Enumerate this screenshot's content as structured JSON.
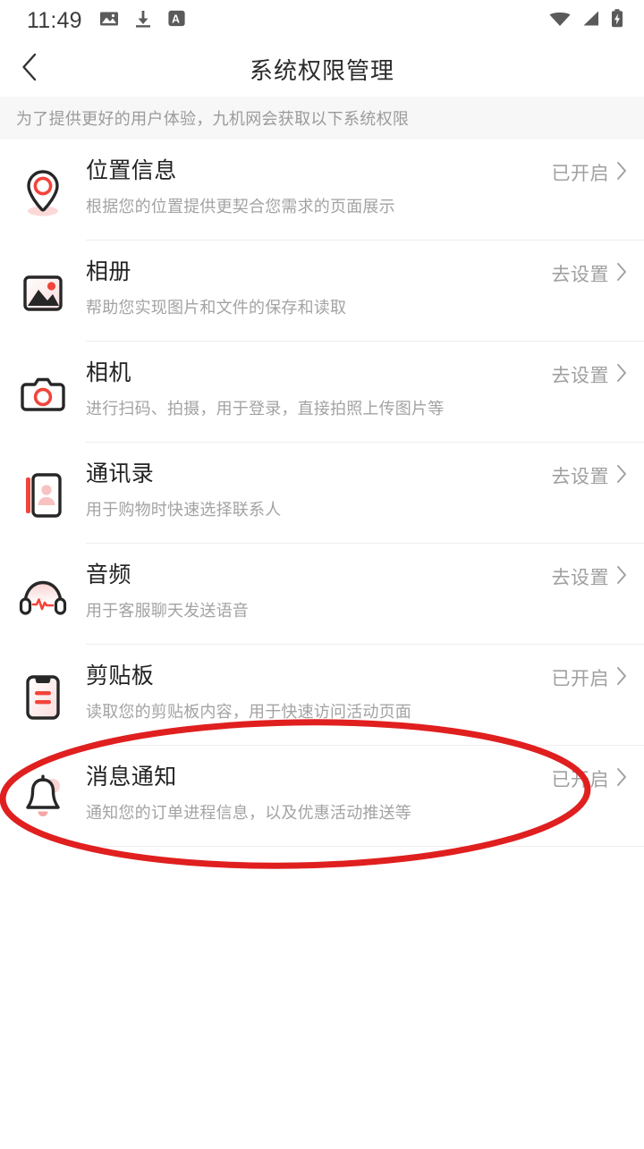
{
  "status_bar": {
    "time": "11:49",
    "left_icons": [
      "image-icon",
      "download-icon",
      "letter-a-icon"
    ],
    "right_icons": [
      "wifi-icon",
      "cellular-signal-icon",
      "battery-charging-icon"
    ]
  },
  "header": {
    "back_icon": "chevron-left-icon",
    "title": "系统权限管理"
  },
  "banner": {
    "text": "为了提供更好的用户体验，九机网会获取以下系统权限"
  },
  "permissions": [
    {
      "icon": "location-pin-icon",
      "title": "位置信息",
      "desc": "根据您的位置提供更契合您需求的页面展示",
      "status": "已开启"
    },
    {
      "icon": "photo-album-icon",
      "title": "相册",
      "desc": "帮助您实现图片和文件的保存和读取",
      "status": "去设置"
    },
    {
      "icon": "camera-icon",
      "title": "相机",
      "desc": "进行扫码、拍摄，用于登录，直接拍照上传图片等",
      "status": "去设置"
    },
    {
      "icon": "contacts-icon",
      "title": "通讯录",
      "desc": "用于购物时快速选择联系人",
      "status": "去设置"
    },
    {
      "icon": "headphones-icon",
      "title": "音频",
      "desc": "用于客服聊天发送语音",
      "status": "去设置"
    },
    {
      "icon": "clipboard-icon",
      "title": "剪贴板",
      "desc": "读取您的剪贴板内容，用于快速访问活动页面",
      "status": "已开启"
    },
    {
      "icon": "bell-icon",
      "title": "消息通知",
      "desc": "通知您的订单进程信息，以及优惠活动推送等",
      "status": "已开启"
    }
  ],
  "annotation": {
    "shape": "ellipse-highlight",
    "target": "消息通知",
    "color": "#e01f1f"
  },
  "colors": {
    "accent_red": "#f2443a",
    "title_text": "#222222",
    "desc_text": "#a3a3a3",
    "status_text": "#a0a0a0",
    "banner_bg": "#f7f7f7",
    "divider": "#ededed",
    "annotation_red": "#e01f1f"
  }
}
